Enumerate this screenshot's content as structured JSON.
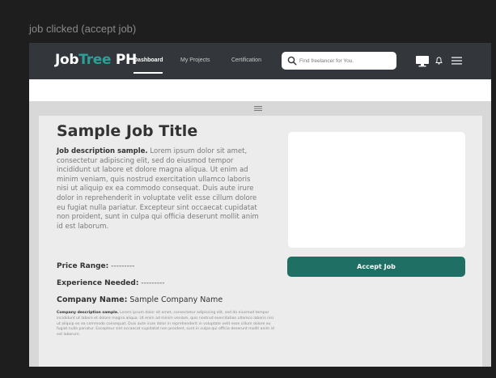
{
  "frame": {
    "label": "job clicked (accept job)"
  },
  "navbar": {
    "logo_part1": "Job",
    "logo_part2": "Tree",
    "logo_part3": " PH",
    "links": [
      {
        "label": "Dashboard",
        "active": true
      },
      {
        "label": "My Projects",
        "active": false
      },
      {
        "label": "Certification",
        "active": false
      }
    ],
    "search_placeholder": "Find freelancer for You.",
    "icons": [
      "search-icon",
      "monitor-icon",
      "bell-icon",
      "menu-icon"
    ]
  },
  "job": {
    "title": "Sample Job Title",
    "desc_lead": "Job description sample.",
    "desc_body": " Lorem ipsum dolor sit amet, consectetur adipiscing elit, sed do eiusmod tempor incididunt ut labore et dolore magna aliqua. Ut enim ad minim veniam, quis nostrud exercitation ullamco laboris nisi ut aliquip ex ea commodo consequat. Duis aute irure dolor in reprehenderit in voluptate velit esse cillum dolore eu fugiat nulla pariatur. Excepteur sint occaecat cupidatat non proident, sunt in culpa qui officia deserunt mollit anim id est laborum.",
    "price_label": "Price Range:",
    "price_value": " ---------",
    "experience_label": "Experience Needed:",
    "experience_value": " ---------",
    "company_label": "Company Name:",
    "company_value": " Sample Company Name",
    "company_desc_lead": "Company description sample.",
    "company_desc_body": " Lorem ipsum dolor sit amet, consectetur adipiscing elit, sed do eiusmod tempor incididunt ut labore et dolore magna aliqua. Ut enim ad minim veniam, quis nostrud exercitation ullamco laboris nisi ut aliquip ex ea commodo consequat. Duis aute irure dolor in reprehenderit in voluptate velit esse cillum dolore eu fugiat nulla pariatur. Excepteur sint occaecat cupidatat non proident, sunt in culpa qui officia deserunt mollit anim id est laborum."
  },
  "actions": {
    "accept_label": "Accept Job"
  },
  "colors": {
    "accent": "#2aa198",
    "button": "#1f6f65",
    "navbar": "#33363a",
    "canvas": "#1e1e1e"
  }
}
